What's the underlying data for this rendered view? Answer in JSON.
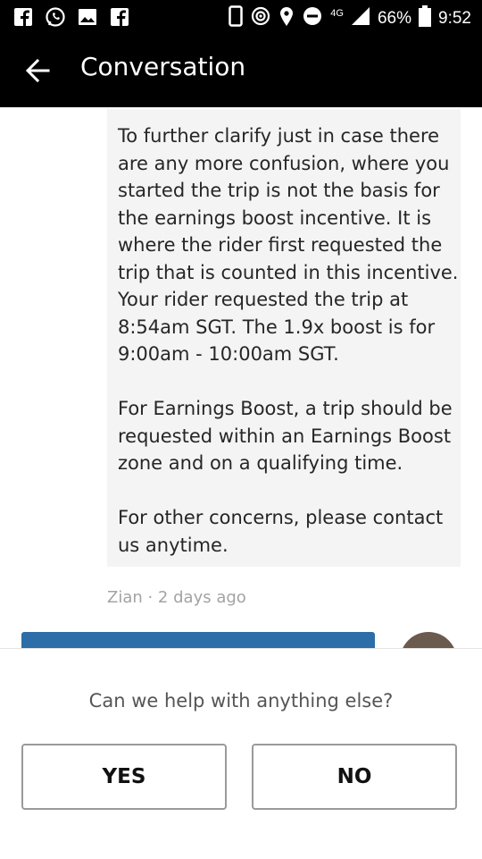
{
  "status_bar": {
    "network": "4G",
    "battery": "66%",
    "time": "9:52"
  },
  "app_bar": {
    "title": "Conversation"
  },
  "message": {
    "paragraphs": [
      "To further clarify just in case there are any more confusion, where you started the trip is not the basis for the earnings boost incentive. It is where the rider first requested the trip that is counted in this incentive. Your rider requested the trip at 8:54am SGT. The 1.9x boost is for 9:00am - 10:00am SGT.",
      "For Earnings Boost, a trip should be requested within an Earnings Boost zone and on a qualifying time.",
      "For other concerns, please contact us anytime."
    ],
    "meta": "Zian · 2 days ago"
  },
  "help_panel": {
    "question": "Can we help with anything else?",
    "yes_label": "YES",
    "no_label": "NO"
  }
}
